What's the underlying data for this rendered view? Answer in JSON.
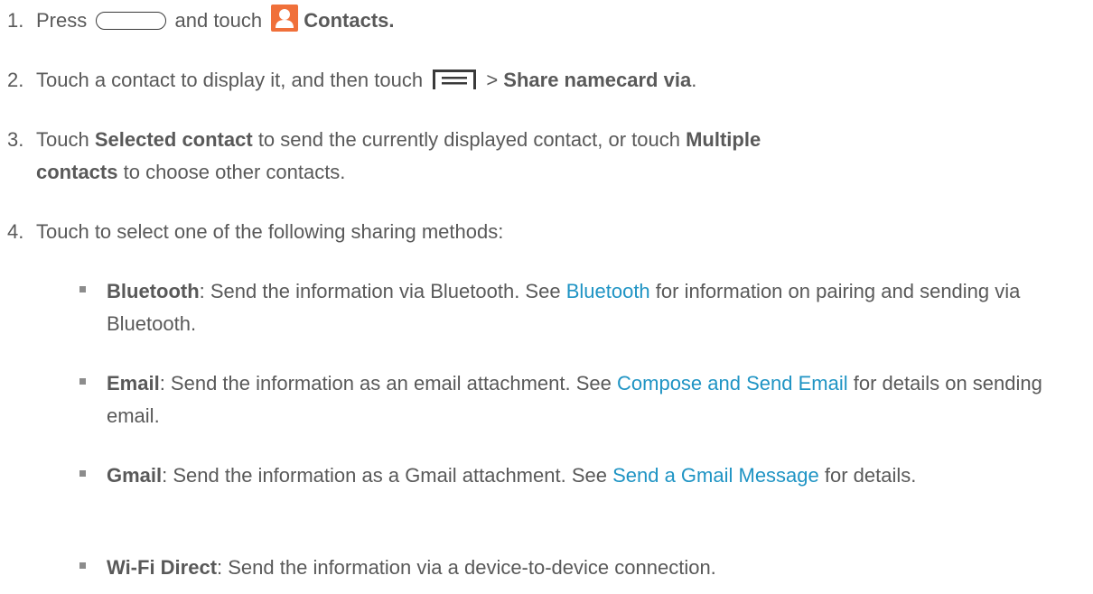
{
  "steps": [
    {
      "num": "1.",
      "press": "Press",
      "and_touch": "and touch",
      "contacts": "Contacts."
    },
    {
      "num": "2.",
      "text": "Touch a contact to display it, and then touch",
      "gt": ">",
      "share": "Share namecard via",
      "end": "."
    },
    {
      "num": "3.",
      "touch": "Touch",
      "selected": "Selected contact",
      "mid": "to send the currently displayed contact, or touch",
      "multiple": "Multiple",
      "contacts_bold": "contacts",
      "end": "to choose other contacts."
    },
    {
      "num": "4.",
      "text": "Touch to select one of the following sharing methods:"
    }
  ],
  "methods": [
    {
      "name": "Bluetooth",
      "desc": ": Send the information via Bluetooth. See",
      "link": "Bluetooth",
      "after": "for information on pairing and sending via Bluetooth."
    },
    {
      "name": "Email",
      "desc": ": Send the information as an email attachment. See",
      "link": "Compose and Send Email",
      "after": "for details on sending email."
    },
    {
      "name": "Gmail",
      "desc": ": Send the information as a Gmail attachment. See",
      "link": "Send a Gmail Message",
      "after": "for details."
    },
    {
      "name": "Wi-Fi Direct",
      "desc": ": Send the information via a device-to-device connection."
    }
  ],
  "icons": {
    "home_button": "home-button-icon",
    "contacts": "contacts-app-icon",
    "menu": "menu-key-icon"
  },
  "colors": {
    "text": "#595959",
    "link": "#1f94c4",
    "contacts_icon": "#f0703a"
  }
}
